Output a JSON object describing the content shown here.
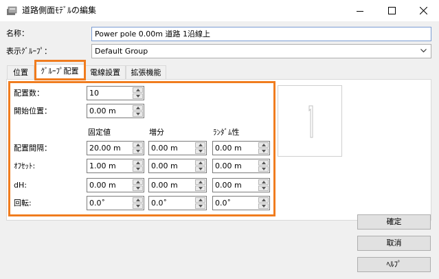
{
  "window": {
    "title": "道路側面ﾓﾃﾞﾙの編集"
  },
  "form": {
    "name_label": "名称：",
    "name_value": "Power pole 0.00m 道路 1沿線上",
    "group_label": "表示ｸﾞﾙｰﾌﾟ：",
    "group_value": "Default Group"
  },
  "tabs": [
    {
      "label": "位置"
    },
    {
      "label": "ｸﾞﾙｰﾌﾟ配置"
    },
    {
      "label": "電線設置"
    },
    {
      "label": "拡張機能"
    }
  ],
  "active_tab": "ｸﾞﾙｰﾌﾟ配置",
  "placement": {
    "count_label": "配置数：",
    "count_value": "10",
    "start_label": "開始位置：",
    "start_value": "0.00 m",
    "columns": [
      "固定値",
      "増分",
      "ﾗﾝﾀﾞﾑ性"
    ],
    "rows": [
      {
        "label": "配置間隔：",
        "values": [
          "20.00 m",
          "0.00 m",
          "0.00 m"
        ]
      },
      {
        "label": "ｵﾌｾｯﾄ:",
        "values": [
          "1.00 m",
          "0.00 m",
          "0.00 m"
        ]
      },
      {
        "label": "dH:",
        "values": [
          "0.00 m",
          "0.00 m",
          "0.00 m"
        ]
      },
      {
        "label": "回転:",
        "values": [
          "0.0˚",
          "0.0˚",
          "0.0˚"
        ]
      }
    ]
  },
  "buttons": {
    "ok": "確定",
    "cancel": "取消",
    "help": "ﾍﾙﾌﾟ"
  },
  "colors": {
    "highlight": "#f07c1e",
    "window_bg": "#f0f0f0"
  },
  "icons": [
    "app-icon",
    "minimize-icon",
    "maximize-icon",
    "close-icon",
    "chevron-down-icon",
    "spinner-up-icon",
    "spinner-down-icon"
  ]
}
